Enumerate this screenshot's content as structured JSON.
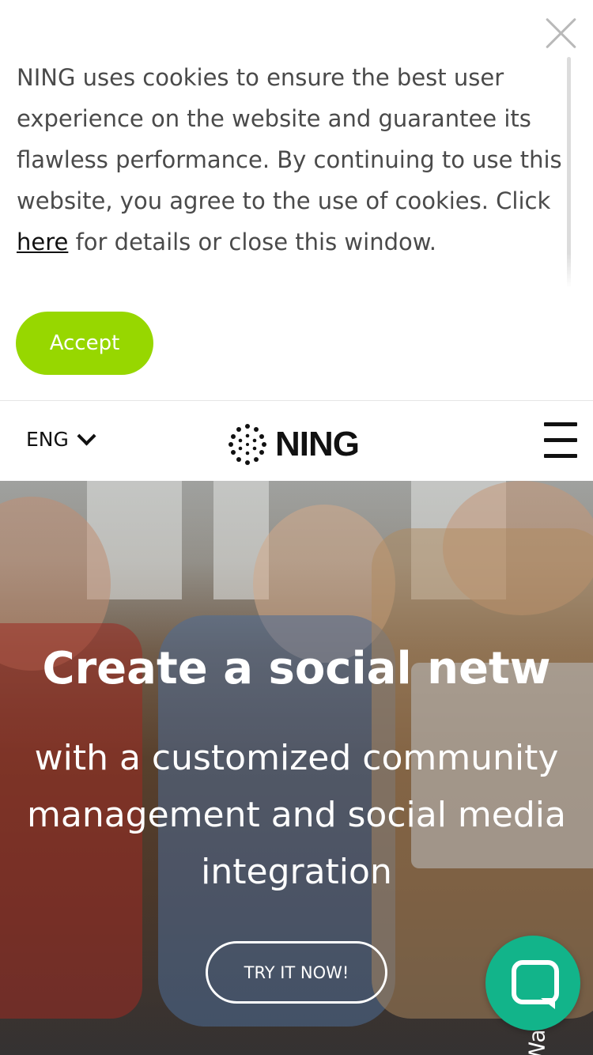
{
  "cookie": {
    "text_before_link": "NING uses cookies to ensure the best user experience on the website and guarantee its flawless performance. By continuing to use this website, you agree to the use of cookies. Click ",
    "link_label": "here",
    "text_after_link": " for details or close this window.",
    "accept_label": "Accept"
  },
  "header": {
    "language": "ENG",
    "logo_text": "NING"
  },
  "hero": {
    "title": "Create a social netw",
    "subtitle": "with a customized community management and social media integration",
    "cta_label": "TRY IT NOW!",
    "side_tab_label": "Wa... o"
  },
  "colors": {
    "accent_green": "#97d700",
    "chat_green": "#12b48a"
  },
  "icons": [
    "close-icon",
    "chevron-down-icon",
    "ning-logo-icon",
    "hamburger-menu-icon",
    "chat-icon"
  ]
}
